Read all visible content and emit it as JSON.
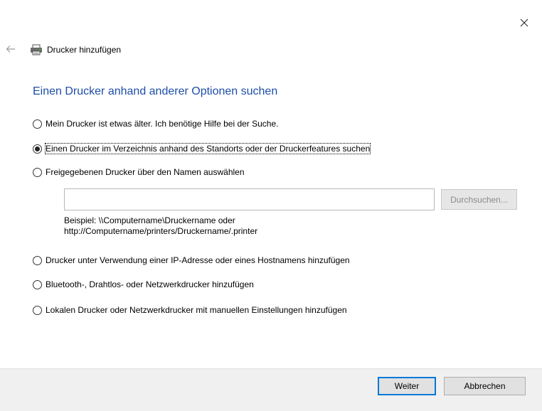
{
  "window": {
    "title": "Drucker hinzufügen",
    "close_icon": "close-icon",
    "back_icon": "back-arrow-icon",
    "title_icon": "printer-icon"
  },
  "heading": "Einen Drucker anhand anderer Optionen suchen",
  "options": [
    {
      "label": "Mein Drucker ist etwas älter. Ich benötige Hilfe bei der Suche.",
      "selected": false
    },
    {
      "label": "Einen Drucker im Verzeichnis anhand des Standorts oder der Druckerfeatures suchen",
      "selected": true
    },
    {
      "label": "Freigegebenen Drucker über den Namen auswählen",
      "selected": false
    },
    {
      "label": "Drucker unter Verwendung einer IP-Adresse oder eines Hostnamens hinzufügen",
      "selected": false
    },
    {
      "label": "Bluetooth-, Drahtlos- oder Netzwerkdrucker hinzufügen",
      "selected": false
    },
    {
      "label": "Lokalen Drucker oder Netzwerkdrucker mit manuellen Einstellungen hinzufügen",
      "selected": false
    }
  ],
  "shared_printer": {
    "input_value": "",
    "browse_label": "Durchsuchen...",
    "example_line1": "Beispiel: \\\\Computername\\Druckername oder",
    "example_line2": "http://Computername/printers/Druckername/.printer"
  },
  "footer": {
    "next_label": "Weiter",
    "cancel_label": "Abbrechen"
  },
  "colors": {
    "heading": "#1e4ea8",
    "default_button_border": "#0078d7",
    "footer_bg": "#f0f0f0"
  }
}
